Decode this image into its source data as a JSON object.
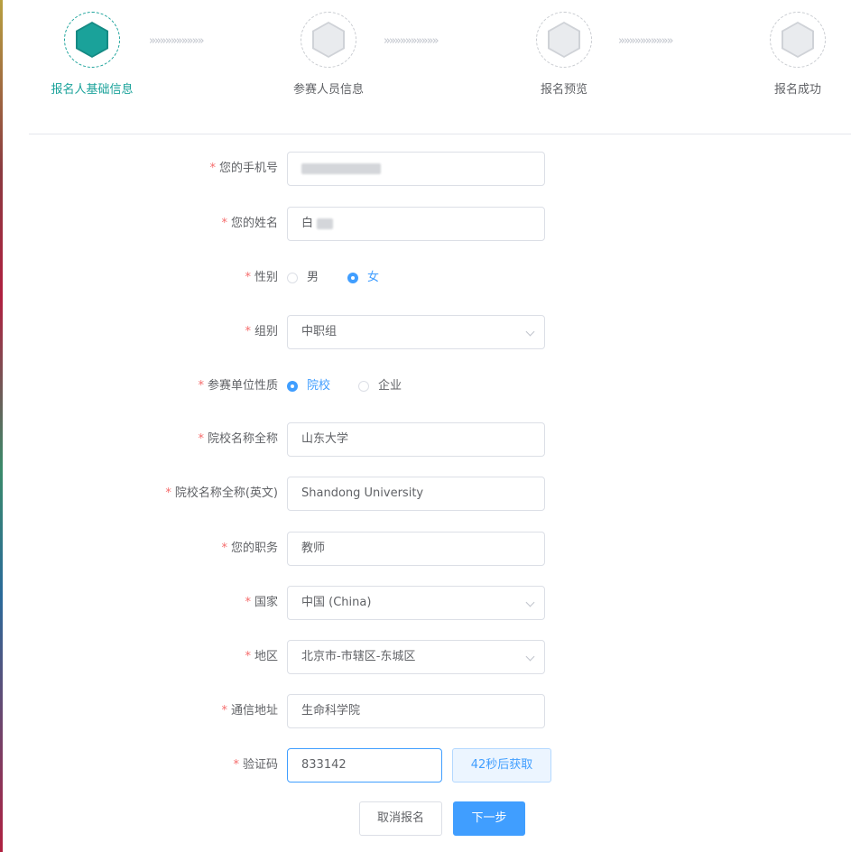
{
  "steps": [
    {
      "label": "报名人基础信息"
    },
    {
      "label": "参赛人员信息"
    },
    {
      "label": "报名预览"
    },
    {
      "label": "报名成功"
    }
  ],
  "step_separator": "»»»»»»»»»»",
  "required_mark": "*",
  "form": {
    "phone": {
      "label": "您的手机号"
    },
    "name": {
      "label": "您的姓名",
      "value_visible": "白"
    },
    "gender": {
      "label": "性别",
      "options": [
        "男",
        "女"
      ],
      "selected": "女"
    },
    "group": {
      "label": "组别",
      "value": "中职组"
    },
    "unit_type": {
      "label": "参赛单位性质",
      "options": [
        "院校",
        "企业"
      ],
      "selected": "院校"
    },
    "school_name": {
      "label": "院校名称全称",
      "value": "山东大学"
    },
    "school_name_en": {
      "label": "院校名称全称(英文)",
      "value": "Shandong University"
    },
    "position": {
      "label": "您的职务",
      "value": "教师"
    },
    "country": {
      "label": "国家",
      "value": "中国 (China)"
    },
    "region": {
      "label": "地区",
      "value": "北京市-市辖区-东城区"
    },
    "address": {
      "label": "通信地址",
      "value": "生命科学院"
    },
    "verify_code": {
      "label": "验证码",
      "value": "833142",
      "button_label": "42秒后获取"
    }
  },
  "actions": {
    "cancel_label": "取消报名",
    "next_label": "下一步"
  },
  "colors": {
    "primary": "#409eff",
    "step_active": "#1aa29a",
    "required": "#f56c6c"
  }
}
